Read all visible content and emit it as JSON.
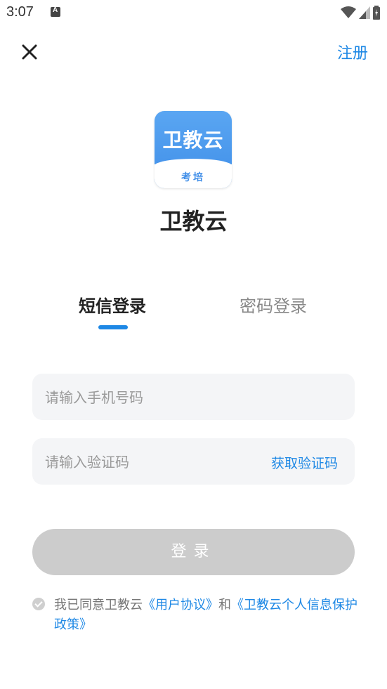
{
  "status_bar": {
    "time": "3:07"
  },
  "header": {
    "register_label": "注册"
  },
  "logo": {
    "title": "卫教云",
    "subtitle": "考培"
  },
  "app_name": "卫教云",
  "tabs": [
    {
      "label": "短信登录",
      "active": true
    },
    {
      "label": "密码登录",
      "active": false
    }
  ],
  "form": {
    "phone_placeholder": "请输入手机号码",
    "phone_value": "",
    "code_placeholder": "请输入验证码",
    "code_value": "",
    "get_code_label": "获取验证码",
    "login_label": "登录"
  },
  "agreement": {
    "prefix": "我已同意卫教云",
    "user_agreement": "《用户协议》",
    "and": "和",
    "privacy_policy": "《卫教云个人信息保护政策》"
  },
  "colors": {
    "accent": "#1e88e5",
    "disabled_button": "#cccccc",
    "input_bg": "#f4f5f7"
  }
}
